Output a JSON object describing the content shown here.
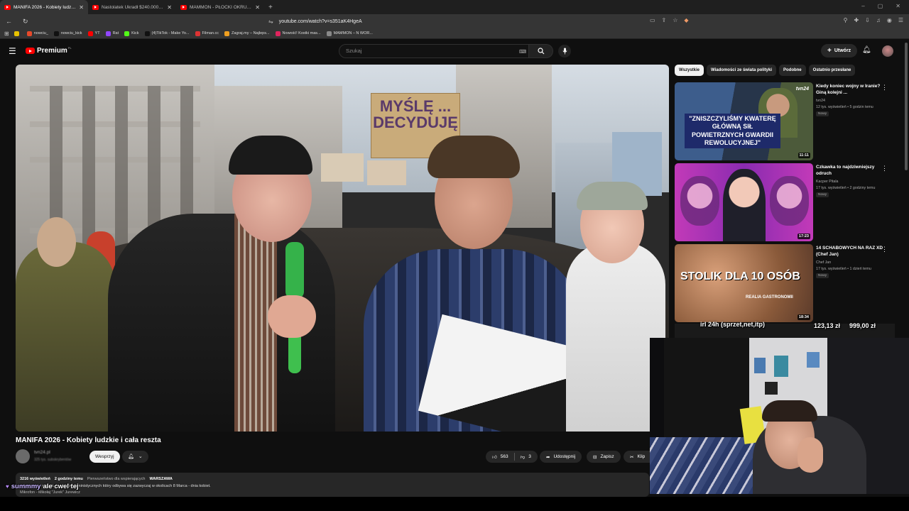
{
  "browser": {
    "tabs": [
      {
        "title": "MANIFA 2026 - Kobiety ludzkie",
        "active": true
      },
      {
        "title": "Nastolatek Ukradł $240.000.000 i Pr",
        "active": false
      },
      {
        "title": "MAMMON - PŁOCKI OKRUTNIK PUB",
        "active": false
      }
    ],
    "new_tab": "+",
    "window_controls": [
      "–",
      "▢",
      "✕"
    ],
    "url": "youtube.com/watch?v=s351aK4HgeA",
    "bookmarks": [
      {
        "label": "",
        "color": "#e8c200"
      },
      {
        "label": "nowciu_",
        "color": "#e8492a"
      },
      {
        "label": "nowciu_kick",
        "color": "#111111"
      },
      {
        "label": "YT",
        "color": "#ff0000"
      },
      {
        "label": "Rat",
        "color": "#9146ff"
      },
      {
        "label": "Kick",
        "color": "#53fc18"
      },
      {
        "label": "(4)TikTok - Make Yo...",
        "color": "#111111"
      },
      {
        "label": "Filman.cc",
        "color": "#d33"
      },
      {
        "label": "Zagraj.my – Najleps...",
        "color": "#f0a020"
      },
      {
        "label": "Nowość! Kostki mas...",
        "color": "#e0245e"
      },
      {
        "label": "MAMMON – N WOR...",
        "color": "#888888"
      }
    ]
  },
  "youtube": {
    "logo_text": "Premium",
    "logo_region": "PL",
    "search_placeholder": "Szukaj",
    "create_label": "Utwórz",
    "chips": [
      "Wszystkie",
      "Wiadomości ze świata polityki",
      "Podobne",
      "Ostatnio przesłane"
    ]
  },
  "video": {
    "title": "MANIFA 2026 - Kobiety ludzkie i cała reszta",
    "channel_name": "tvn24.pl",
    "channel_subs": "325 tys. subskrybentów",
    "support_label": "Wesprzyj",
    "likes": "563",
    "dislikes": "3",
    "share_label": "Udostępnij",
    "save_label": "Zapisz",
    "clip_label": "Klip",
    "sign_text": "MYŚLĘ ... DECYDUJĘ",
    "views": "3216 wyświetleń",
    "age": "2 godziny temu",
    "priority_label": "Pierwszeństwo dla wspierających",
    "location_tag": "WARSZAWA",
    "description": "...dycyjnego marszu środowisk feministycznych który odbywa się zazwyczaj w okolicach 8 Marca - dnia kobiet.",
    "description_more": "Mikrofon - Mikołaj \"Jurek\" Jurewicz"
  },
  "recommendations": [
    {
      "title": "Kiedy koniec wojny w Iranie? Giną kolejni ...",
      "channel": "tvn24",
      "meta": "12 tys. wyświetleń • 5 godzin temu",
      "badge": "Nowy",
      "duration": "11:11",
      "thumb_text": "\"ZNISZCZYLIŚMY KWATERĘ GŁÓWNĄ SIŁ POWIETRZNYCH GWARDII REWOLUCYJNEJ\"",
      "thumb_logo": "tvn24"
    },
    {
      "title": "Czkawka to najdziwniejszy odruch",
      "channel": "Kacper Pitala",
      "meta": "17 tys. wyświetleń • 2 godziny temu",
      "badge": "Nowy",
      "duration": "17:23"
    },
    {
      "title": "14 SCHABOWYCH NA RAZ XD (Chef Jan)",
      "channel": "Chef Jan",
      "meta": "17 tys. wyświetleń • 1 dzień temu",
      "badge": "Nowy",
      "duration": "18:34",
      "thumb_text": "STOLIK DLA 10 OSÓB",
      "thumb_sub": "REALIA GASTRONOMII"
    }
  ],
  "stream_overlay": {
    "ticker": "irl 24h (sprzet,net,itp)",
    "amount_current": "123,13 zł",
    "amount_goal": "999,00 zł",
    "chat_user": "summmy",
    "chat_message": "ale cwel tej"
  },
  "icons": [
    "menu-icon",
    "search-icon",
    "mic-icon",
    "bell-icon",
    "like-icon",
    "dislike-icon",
    "share-icon",
    "save-icon",
    "clip-icon",
    "more-vert-icon",
    "keyboard-icon"
  ]
}
